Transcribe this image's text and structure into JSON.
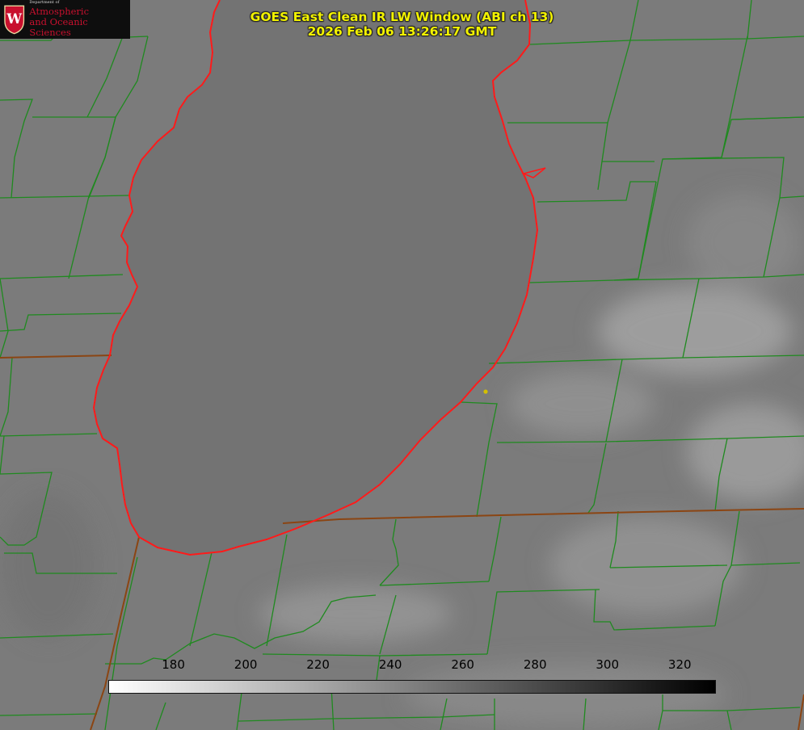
{
  "title": {
    "line1": "GOES East Clean IR LW Window (ABI ch 13)",
    "line2": "2026 Feb 06 13:26:17 GMT"
  },
  "logo": {
    "dept": "Department of",
    "line1": "Atmospheric",
    "line2": "and Oceanic Sciences",
    "seal_letter": "W"
  },
  "colorbar": {
    "min": 162,
    "max": 330,
    "ticks": [
      180,
      200,
      220,
      240,
      260,
      280,
      300,
      320
    ],
    "tick_labels": [
      "180",
      "200",
      "220",
      "240",
      "260",
      "280",
      "300",
      "320"
    ],
    "gradient_start": "#ffffff",
    "gradient_end": "#000000"
  },
  "colors": {
    "coastline": "#ff1a1a",
    "county_lines": "#1f8a1f",
    "state_lines": "#8b4513",
    "title": "#f2f200",
    "marker": "#d4c000",
    "logo_red": "#c8102e"
  }
}
